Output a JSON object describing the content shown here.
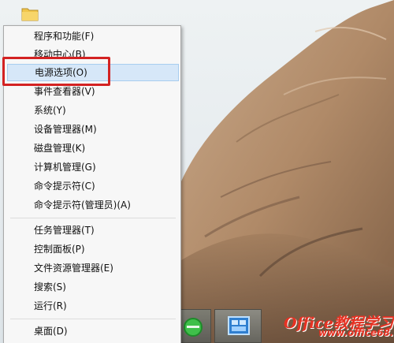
{
  "menu": {
    "items": [
      {
        "label": "程序和功能(F)"
      },
      {
        "label": "移动中心(B)"
      },
      {
        "label": "电源选项(O)"
      },
      {
        "label": "事件查看器(V)"
      },
      {
        "label": "系统(Y)"
      },
      {
        "label": "设备管理器(M)"
      },
      {
        "label": "磁盘管理(K)"
      },
      {
        "label": "计算机管理(G)"
      },
      {
        "label": "命令提示符(C)"
      },
      {
        "label": "命令提示符(管理员)(A)"
      },
      {
        "label": "任务管理器(T)"
      },
      {
        "label": "控制面板(P)"
      },
      {
        "label": "文件资源管理器(E)"
      },
      {
        "label": "搜索(S)"
      },
      {
        "label": "运行(R)"
      },
      {
        "label": "桌面(D)"
      }
    ],
    "highlighted_label": "电源选项(O)"
  },
  "watermark": {
    "site": "Office教程学习网",
    "url": "www.office68.com"
  },
  "colors": {
    "highlight_bg": "#d6e7f8",
    "annotation_box": "#d32222",
    "watermark": "#e63223"
  }
}
